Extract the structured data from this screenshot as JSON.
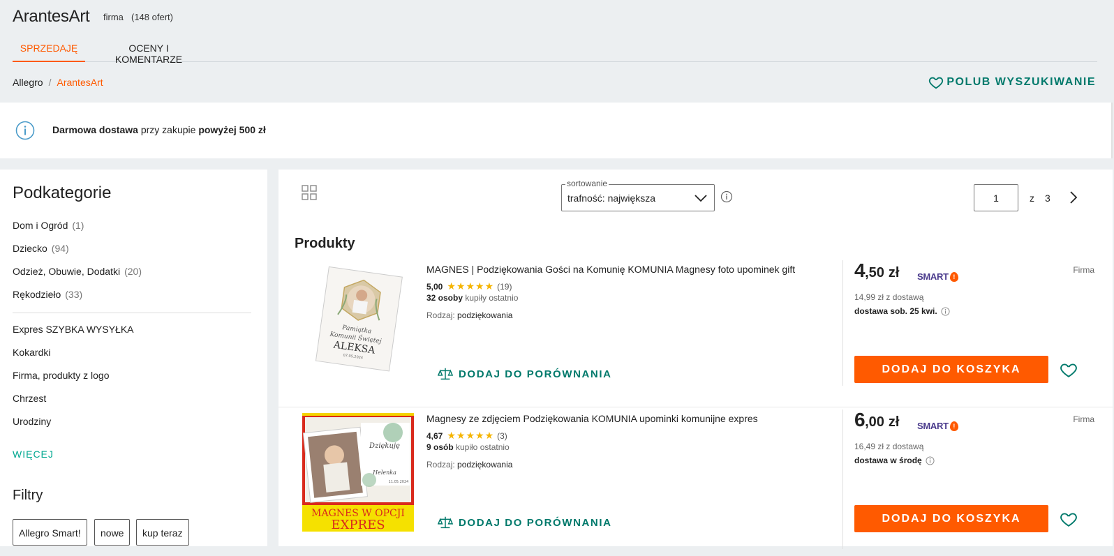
{
  "header": {
    "store_name": "ArantesArt",
    "store_type": "firma",
    "offers_count": "(148 ofert)",
    "tabs": [
      {
        "label": "SPRZEDAJĘ"
      },
      {
        "label": "OCENY I KOMENTARZE"
      }
    ]
  },
  "breadcrumb": {
    "root": "Allegro",
    "separator": "/",
    "current": "ArantesArt"
  },
  "like_search": {
    "label": "POLUB WYSZUKIWANIE"
  },
  "banner": {
    "part1": "Darmowa dostawa",
    "part2": " przy zakupie ",
    "part3": "powyżej 500 zł"
  },
  "sidebar": {
    "title": "Podkategorie",
    "categories": [
      {
        "label": "Dom i Ogród",
        "count": "(1)"
      },
      {
        "label": "Dziecko",
        "count": "(94)"
      },
      {
        "label": "Odzież, Obuwie, Dodatki",
        "count": "(20)"
      },
      {
        "label": "Rękodzieło",
        "count": "(33)"
      }
    ],
    "links": [
      {
        "label": "Expres SZYBKA WYSYŁKA"
      },
      {
        "label": "Kokardki"
      },
      {
        "label": "Firma, produkty z logo"
      },
      {
        "label": "Chrzest"
      },
      {
        "label": "Urodziny"
      }
    ],
    "more_label": "WIĘCEJ",
    "filters_title": "Filtry",
    "filter_chips": [
      {
        "label": "Allegro Smart!"
      },
      {
        "label": "nowe"
      },
      {
        "label": "kup teraz"
      }
    ]
  },
  "toolbar": {
    "sort_label": "sortowanie",
    "sort_value": "trafność: największa",
    "page_current": "1",
    "page_of": "z",
    "page_total": "3"
  },
  "products_title": "Produkty",
  "products": [
    {
      "title": "MAGNES | Podziękowania Gości na Komunię KOMUNIA Magnesy foto upominek gift",
      "rating": "5,00",
      "stars": "★★★★★",
      "rating_count": "(19)",
      "bought_count": "32 osoby",
      "bought_text": " kupiły ostatnio",
      "param_label": "Rodzaj: ",
      "param_value": "podziękowania",
      "compare_label": "DODAJ DO PORÓWNANIA",
      "price_int": "4",
      "price_frac": ",50",
      "currency": "zł",
      "smart_label": "SMART",
      "seller_type": "Firma",
      "shipping_price": "14,99 zł z dostawą",
      "delivery": "dostawa sob. 25 kwi.",
      "cart_label": "DODAJ DO KOSZYKA",
      "thumb_text1": "Pamiątka",
      "thumb_text2": "Komunii Świętej",
      "thumb_text3": "ALEKSA",
      "thumb_date": "07.05.2024"
    },
    {
      "title": "Magnesy ze zdjęciem Podziękowania KOMUNIA upominki komunijne expres",
      "rating": "4,67",
      "stars": "★★★★★",
      "rating_count": "(3)",
      "bought_count": "9 osób",
      "bought_text": " kupiło ostatnio",
      "param_label": "Rodzaj: ",
      "param_value": "podziękowania",
      "compare_label": "DODAJ DO PORÓWNANIA",
      "price_int": "6",
      "price_frac": ",00",
      "currency": "zł",
      "smart_label": "SMART",
      "seller_type": "Firma",
      "shipping_price": "16,49 zł z dostawą",
      "delivery": "dostawa w środę",
      "cart_label": "DODAJ DO KOSZYKA",
      "thumb_text1": "Dziękuję",
      "thumb_text2": "Helenka",
      "thumb_date": "11.05.2024",
      "thumb_banner1": "MAGNES W OPCJI",
      "thumb_banner2": "EXPRES"
    }
  ],
  "colors": {
    "accent": "#ff5a00",
    "teal": "#00796b",
    "page_bg": "#eceff1",
    "smart": "#4a3a8c",
    "stars": "#f5b400"
  }
}
